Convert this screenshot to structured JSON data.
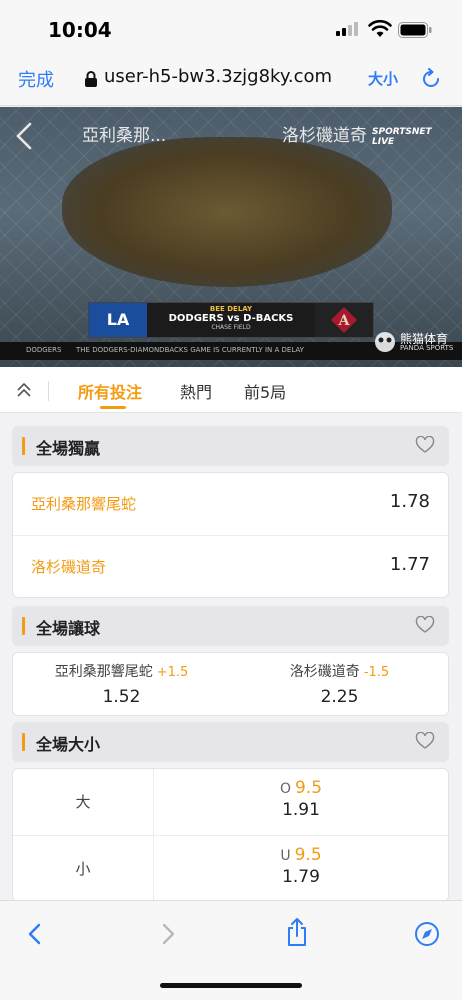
{
  "status": {
    "time": "10:04"
  },
  "browser": {
    "done_label": "完成",
    "url": "user-h5-bw3.3zjg8ky.com",
    "text_size_label": "大小"
  },
  "video": {
    "team_left": "亞利桑那...",
    "team_right": "洛杉磯道奇",
    "channel": "SPORTSNET LIVE",
    "banner_top": "BEE DELAY",
    "banner_match": "DODGERS vs D-BACKS",
    "banner_venue": "CHASE FIELD",
    "home_logo_text": "LA",
    "ticker_left": "DODGERS",
    "ticker_text": "THE DODGERS-DIAMONDBACKS GAME IS CURRENTLY IN A DELAY",
    "brand": "熊猫体育",
    "brand_sub": "PANDA SPORTS"
  },
  "tabs": [
    {
      "label": "所有投注",
      "active": true
    },
    {
      "label": "熱門",
      "active": false
    },
    {
      "label": "前5局",
      "active": false
    }
  ],
  "markets": {
    "moneyline": {
      "title": "全場獨贏",
      "rows": [
        {
          "team": "亞利桑那響尾蛇",
          "odds": "1.78"
        },
        {
          "team": "洛杉磯道奇",
          "odds": "1.77"
        }
      ]
    },
    "handicap": {
      "title": "全場讓球",
      "cells": [
        {
          "team": "亞利桑那響尾蛇",
          "line": "+1.5",
          "odds": "1.52"
        },
        {
          "team": "洛杉磯道奇",
          "line": "-1.5",
          "odds": "2.25"
        }
      ]
    },
    "total": {
      "title": "全場大小",
      "rows": [
        {
          "label": "大",
          "prefix": "O",
          "line": "9.5",
          "odds": "1.91"
        },
        {
          "label": "小",
          "prefix": "U",
          "line": "9.5",
          "odds": "1.79"
        }
      ]
    }
  },
  "colors": {
    "accent": "#f39c12",
    "link": "#2f7cf6"
  }
}
